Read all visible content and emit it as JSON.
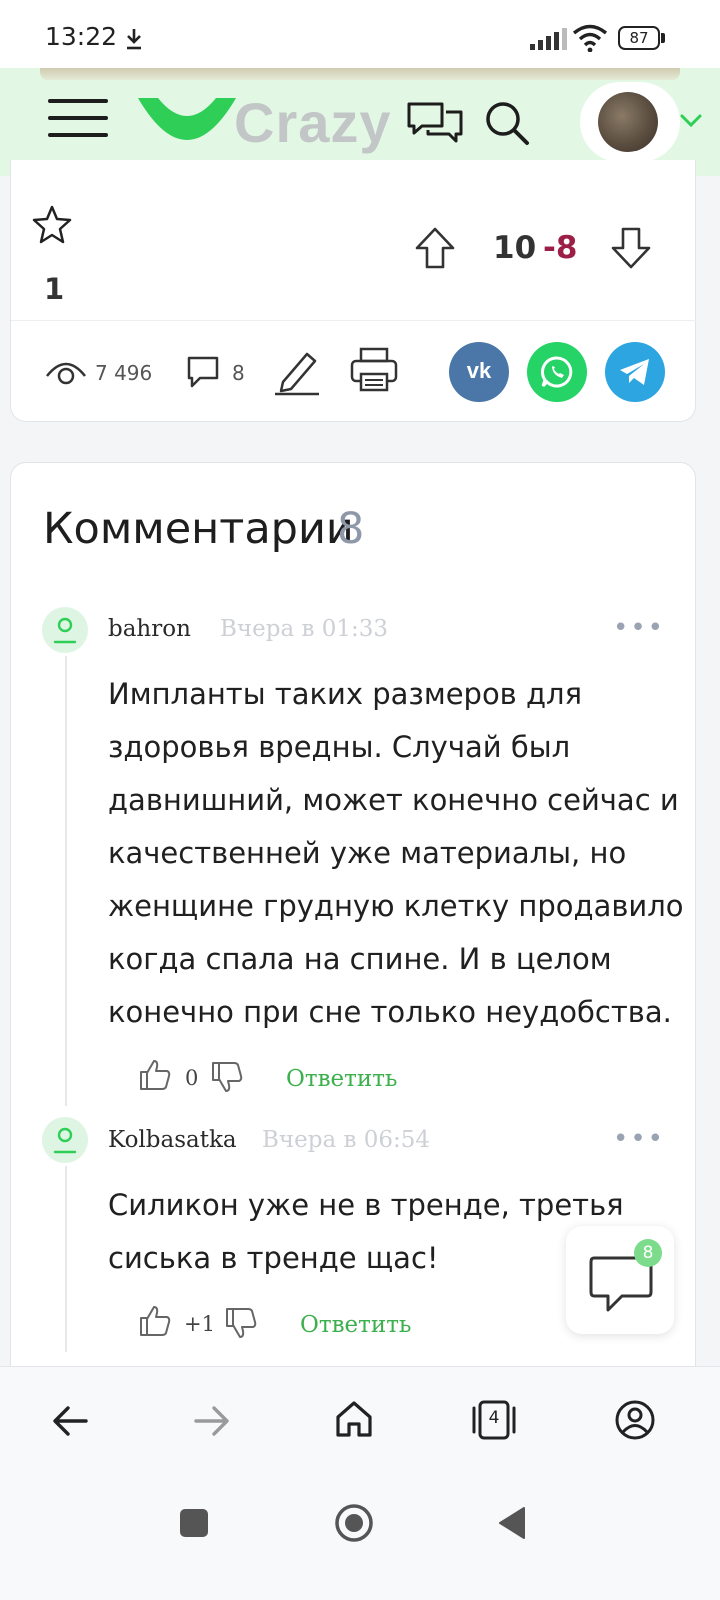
{
  "status_bar": {
    "time": "13:22",
    "battery": "87",
    "icons": [
      "download-icon",
      "signal-icon",
      "wifi-icon",
      "battery-icon"
    ]
  },
  "header": {
    "logo_text": "Crazy",
    "icons": [
      "menu-icon",
      "chats-icon",
      "search-icon",
      "user-avatar",
      "chevron-down-icon"
    ]
  },
  "rating": {
    "favorites_count": "1",
    "upvotes": "10",
    "downvotes": "-8"
  },
  "post_meta": {
    "views": "7 496",
    "comments": "8"
  },
  "share": {
    "vk_color": "#4a76a8",
    "whatsapp_color": "#25d366",
    "telegram_color": "#2ca5e0"
  },
  "comments_section": {
    "title": "Комментарии",
    "count": "8",
    "items": [
      {
        "author": "bahron",
        "time": "Вчера в 01:33",
        "lines": [
          "Импланты таких размеров для",
          "здоровья вредны. Случай был",
          "давнишний, может конечно сейчас и",
          "качественней уже материалы, но",
          "женщине грудную клетку продавило",
          "когда спала на спине. И в целом",
          "конечно при сне только неудобства."
        ],
        "likes": "0",
        "reply_label": "Ответить"
      },
      {
        "author": "Kolbasatka",
        "time": "Вчера в 06:54",
        "lines": [
          "Силикон уже не в тренде, третья",
          "сиська в тренде щас!"
        ],
        "likes": "+1",
        "reply_label": "Ответить"
      }
    ]
  },
  "floating_chat": {
    "badge": "8"
  },
  "browser": {
    "tab_count": "4"
  },
  "colors": {
    "brand_green": "#2fcf57",
    "downvote_red": "#9b1f47",
    "reply_green": "#3cb04d"
  }
}
